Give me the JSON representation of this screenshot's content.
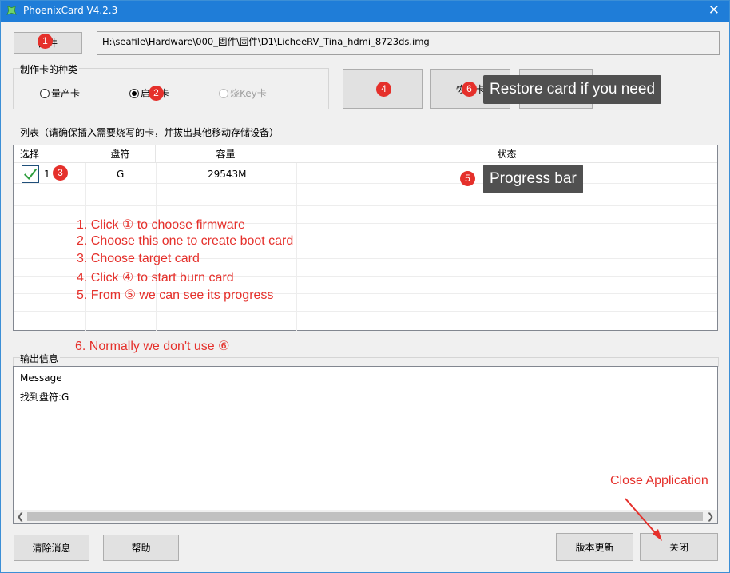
{
  "window": {
    "title": "PhoenixCard V4.2.3"
  },
  "buttons": {
    "firmware_label": "固件",
    "burn_label": "烧",
    "restore_label": "恢复卡",
    "settings_label": "",
    "clear_label": "清除消息",
    "help_label": "帮助",
    "update_label": "版本更新",
    "close_label": "关闭"
  },
  "firmware_path": "H:\\seafile\\Hardware\\000_固件\\固件\\D1\\LicheeRV_Tina_hdmi_8723ds.img",
  "card_type": {
    "label": "制作卡的种类",
    "options": [
      {
        "label": "量产卡",
        "checked": false
      },
      {
        "label": "启动卡",
        "checked": true
      },
      {
        "label": "烧Key卡",
        "checked": false,
        "disabled": true
      }
    ]
  },
  "list": {
    "label": "列表（请确保插入需要烧写的卡，并拔出其他移动存储设备）",
    "headers": [
      "选择",
      "盘符",
      "容量",
      "状态"
    ],
    "rows": [
      {
        "index": "1",
        "drive": "G",
        "capacity": "29543M",
        "status": ""
      }
    ]
  },
  "output": {
    "label": "输出信息",
    "lines": [
      "Message",
      "找到盘符:G"
    ]
  },
  "annotations": {
    "badges": [
      "1",
      "2",
      "3",
      "4",
      "5",
      "6"
    ],
    "tip_restore": "Restore card if you need",
    "tip_progress": "Progress bar",
    "steps": [
      "1. Click ① to choose firmware",
      "2. Choose this one to create boot card",
      "3. Choose target card",
      "4. Click ④ to start burn card",
      "5. From ⑤ we can see its progress"
    ],
    "note6": "6. Normally we don't use ⑥",
    "close_note": "Close Application"
  },
  "colors": {
    "titlebar": "#1f7dd8",
    "annotation_red": "#e5302b",
    "tooltip_bg": "#505050",
    "checkmark": "#2e9e3e"
  }
}
